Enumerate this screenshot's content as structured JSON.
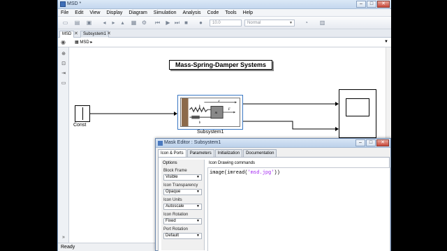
{
  "window": {
    "title": "MSD *"
  },
  "menu": [
    "File",
    "Edit",
    "View",
    "Display",
    "Diagram",
    "Simulation",
    "Analysis",
    "Code",
    "Tools",
    "Help"
  ],
  "toolbar": {
    "stop_time": "10.0",
    "sim_mode": "Normal"
  },
  "tabs": [
    {
      "label": "MSD",
      "active": true
    },
    {
      "label": "Subsystem1",
      "active": false
    }
  ],
  "breadcrumb": "MSD",
  "diagram": {
    "title": "Mass-Spring-Damper Systems",
    "const_label": "Const",
    "subsystem_label": "Subsystem1",
    "image_labels": {
      "x": "x",
      "k": "k",
      "b": "b",
      "m": "m",
      "F": "F"
    }
  },
  "status": "Ready",
  "mask_editor": {
    "title": "Mask Editor : Subsystem1",
    "tabs": [
      "Icon & Ports",
      "Parameters",
      "Initialization",
      "Documentation"
    ],
    "options_header": "Options",
    "options": [
      {
        "label": "Block Frame",
        "value": "Visible"
      },
      {
        "label": "Icon Transparency",
        "value": "Opaque"
      },
      {
        "label": "Icon Units",
        "value": "Autoscale"
      },
      {
        "label": "Icon Rotation",
        "value": "Fixed"
      },
      {
        "label": "Port Rotation",
        "value": "Default"
      }
    ],
    "commands_header": "Icon Drawing commands",
    "command_fn": "image(imread(",
    "command_str": "'msd.jpg'",
    "command_end": "))"
  },
  "colors": {
    "accent": "#3a78c3",
    "mass_block": "#8c6a4a",
    "string_purple": "#a020f0"
  }
}
